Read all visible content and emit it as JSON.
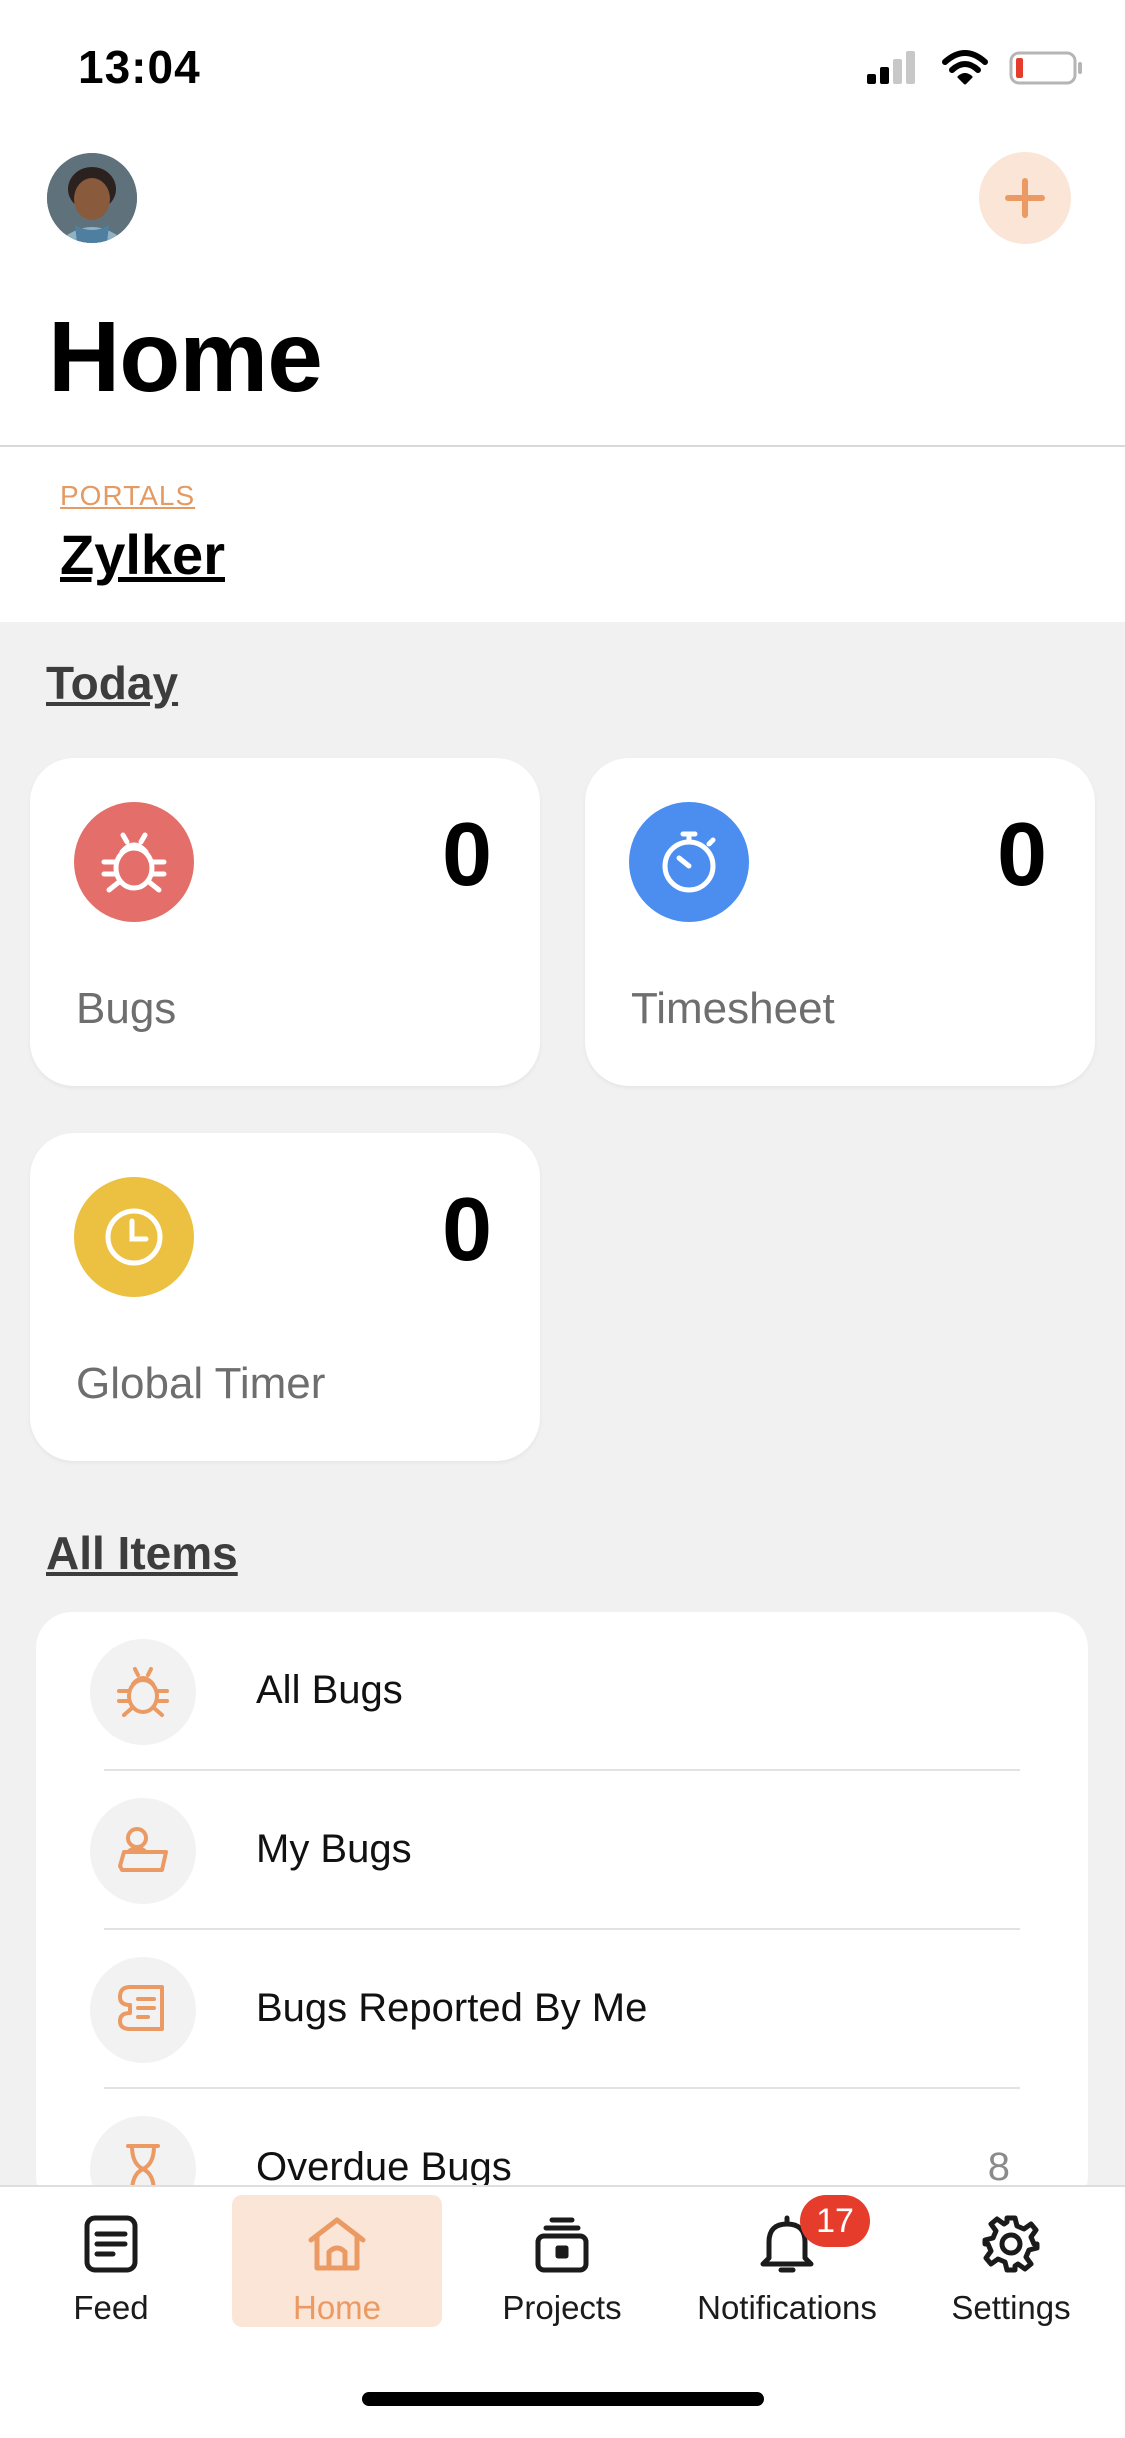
{
  "status_bar": {
    "time": "13:04"
  },
  "header": {
    "title": "Home",
    "add_icon": "plus-icon"
  },
  "portal": {
    "label": "PORTALS",
    "name": "Zylker"
  },
  "today": {
    "heading": "Today",
    "cards": [
      {
        "label": "Bugs",
        "count": "0",
        "icon": "bug-icon",
        "color": "#e46f6a"
      },
      {
        "label": "Timesheet",
        "count": "0",
        "icon": "stopwatch-icon",
        "color": "#4b8ef0"
      },
      {
        "label": "Global Timer",
        "count": "0",
        "icon": "clock-icon",
        "color": "#ecc041"
      }
    ]
  },
  "all_items": {
    "heading": "All Items",
    "items": [
      {
        "label": "All Bugs",
        "icon": "bug-outline-icon"
      },
      {
        "label": "My Bugs",
        "icon": "user-bug-icon"
      },
      {
        "label": "Bugs Reported By Me",
        "icon": "report-icon"
      },
      {
        "label": "Overdue Bugs",
        "icon": "hourglass-icon",
        "count": "8"
      }
    ]
  },
  "tabs": [
    {
      "label": "Feed",
      "icon": "feed-icon"
    },
    {
      "label": "Home",
      "icon": "home-icon",
      "active": true
    },
    {
      "label": "Projects",
      "icon": "projects-icon"
    },
    {
      "label": "Notifications",
      "icon": "bell-icon",
      "badge": "17"
    },
    {
      "label": "Settings",
      "icon": "gear-icon"
    }
  ],
  "colors": {
    "accent": "#ea9a62",
    "accent_light": "#fbe5d6",
    "badge": "#e53c2c"
  }
}
